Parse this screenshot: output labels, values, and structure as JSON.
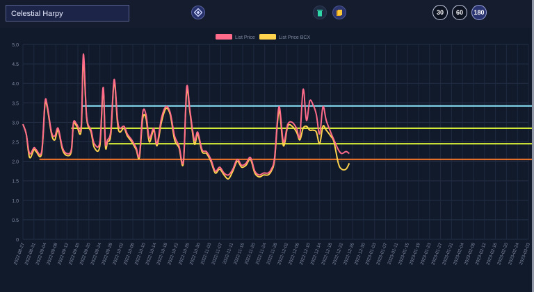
{
  "header": {
    "title": "Celestial Harpy",
    "range_buttons": [
      "30",
      "60",
      "180"
    ],
    "active_range": "180",
    "icons": [
      "logo-icon",
      "trash-icon",
      "cards-icon"
    ]
  },
  "colors": {
    "background": "#111a2b",
    "list_price": "#ff6b8a",
    "list_price_bcx": "#ffd34d",
    "line_cyan": "#8ee8ff",
    "line_yellow": "#e8ff3a",
    "line_orange": "#ff7a2a"
  },
  "chart_data": {
    "type": "line",
    "legend": [
      "List Price",
      "List Price BCX"
    ],
    "legend_position": "top",
    "ylim": [
      0,
      5
    ],
    "yticks": [
      "0",
      "0.5",
      "1.0",
      "1.5",
      "2.0",
      "2.5",
      "3.0",
      "3.5",
      "4.0",
      "4.5",
      "5.0"
    ],
    "xticks": [
      "2022-08-27",
      "2022-08-31",
      "2022-09-04",
      "2022-09-08",
      "2022-09-12",
      "2022-09-16",
      "2022-09-20",
      "2022-09-24",
      "2022-09-28",
      "2022-10-02",
      "2022-10-06",
      "2022-10-10",
      "2022-10-14",
      "2022-10-18",
      "2022-10-22",
      "2022-10-26",
      "2022-10-30",
      "2022-11-03",
      "2022-11-07",
      "2022-11-11",
      "2022-11-16",
      "2022-11-20",
      "2022-11-24",
      "2022-11-28",
      "2022-12-02",
      "2022-12-06",
      "2022-12-10",
      "2022-12-14",
      "2022-12-18",
      "2022-12-22",
      "2022-12-26",
      "2022-12-30",
      "2023-01-03",
      "2023-01-07",
      "2023-01-11",
      "2023-01-15",
      "2023-01-19",
      "2023-01-23",
      "2023-01-27",
      "2023-01-31",
      "2023-02-04",
      "2023-02-08",
      "2023-02-12",
      "2023-02-16",
      "2023-02-20",
      "2023-02-24",
      "2023-03-03"
    ],
    "grid": true,
    "series": [
      {
        "name": "List Price",
        "points": [
          [
            0,
            2.95
          ],
          [
            0.3,
            2.7
          ],
          [
            0.6,
            2.2
          ],
          [
            1.0,
            2.35
          ],
          [
            1.2,
            2.3
          ],
          [
            1.7,
            2.25
          ],
          [
            2.0,
            3.5
          ],
          [
            2.2,
            3.45
          ],
          [
            2.6,
            2.75
          ],
          [
            2.9,
            2.65
          ],
          [
            3.2,
            2.85
          ],
          [
            3.6,
            2.35
          ],
          [
            4.0,
            2.2
          ],
          [
            4.4,
            2.3
          ],
          [
            4.6,
            3.0
          ],
          [
            4.9,
            2.95
          ],
          [
            5.3,
            2.9
          ],
          [
            5.5,
            4.75
          ],
          [
            5.8,
            3.15
          ],
          [
            6.2,
            2.8
          ],
          [
            6.5,
            2.45
          ],
          [
            7.0,
            2.5
          ],
          [
            7.3,
            3.9
          ],
          [
            7.5,
            2.5
          ],
          [
            7.7,
            2.55
          ],
          [
            8.0,
            2.8
          ],
          [
            8.3,
            4.1
          ],
          [
            8.6,
            3.1
          ],
          [
            8.8,
            2.85
          ],
          [
            9.2,
            2.9
          ],
          [
            9.5,
            2.7
          ],
          [
            9.9,
            2.55
          ],
          [
            10.3,
            2.35
          ],
          [
            10.6,
            2.15
          ],
          [
            10.9,
            3.25
          ],
          [
            11.2,
            3.2
          ],
          [
            11.5,
            2.6
          ],
          [
            11.9,
            2.85
          ],
          [
            12.2,
            2.45
          ],
          [
            12.6,
            3.1
          ],
          [
            13.0,
            3.4
          ],
          [
            13.4,
            3.25
          ],
          [
            13.8,
            2.65
          ],
          [
            14.2,
            2.4
          ],
          [
            14.6,
            2.0
          ],
          [
            14.9,
            3.9
          ],
          [
            15.2,
            3.3
          ],
          [
            15.6,
            2.55
          ],
          [
            15.9,
            2.75
          ],
          [
            16.3,
            2.3
          ],
          [
            16.7,
            2.25
          ],
          [
            17.1,
            2.05
          ],
          [
            17.5,
            1.75
          ],
          [
            17.9,
            1.85
          ],
          [
            18.3,
            1.7
          ],
          [
            18.7,
            1.65
          ],
          [
            19.1,
            1.8
          ],
          [
            19.5,
            2.05
          ],
          [
            19.9,
            1.9
          ],
          [
            20.3,
            1.95
          ],
          [
            20.7,
            2.1
          ],
          [
            21.1,
            1.75
          ],
          [
            21.5,
            1.65
          ],
          [
            21.9,
            1.7
          ],
          [
            22.3,
            1.7
          ],
          [
            22.6,
            1.8
          ],
          [
            22.9,
            2.1
          ],
          [
            23.3,
            3.4
          ],
          [
            23.7,
            2.5
          ],
          [
            24.1,
            2.95
          ],
          [
            24.5,
            3.0
          ],
          [
            24.9,
            2.85
          ],
          [
            25.2,
            2.65
          ],
          [
            25.5,
            3.85
          ],
          [
            25.8,
            3.05
          ],
          [
            26.1,
            3.55
          ],
          [
            26.4,
            3.45
          ],
          [
            26.7,
            3.2
          ],
          [
            27.0,
            2.7
          ],
          [
            27.3,
            3.4
          ],
          [
            27.6,
            3.05
          ],
          [
            28.0,
            2.75
          ],
          [
            28.3,
            2.55
          ],
          [
            28.7,
            2.3
          ],
          [
            29.0,
            2.2
          ],
          [
            29.4,
            2.25
          ],
          [
            29.7,
            2.2
          ]
        ]
      },
      {
        "name": "List Price BCX",
        "points": [
          [
            0,
            2.95
          ],
          [
            0.3,
            2.7
          ],
          [
            0.6,
            2.1
          ],
          [
            1.0,
            2.3
          ],
          [
            1.2,
            2.25
          ],
          [
            1.7,
            2.2
          ],
          [
            2.0,
            3.45
          ],
          [
            2.2,
            3.4
          ],
          [
            2.6,
            2.7
          ],
          [
            2.9,
            2.55
          ],
          [
            3.2,
            2.8
          ],
          [
            3.6,
            2.3
          ],
          [
            4.0,
            2.15
          ],
          [
            4.4,
            2.25
          ],
          [
            4.6,
            2.95
          ],
          [
            4.9,
            2.9
          ],
          [
            5.3,
            2.8
          ],
          [
            5.5,
            4.6
          ],
          [
            5.8,
            3.1
          ],
          [
            6.2,
            2.75
          ],
          [
            6.5,
            2.35
          ],
          [
            7.0,
            2.4
          ],
          [
            7.3,
            3.85
          ],
          [
            7.5,
            2.4
          ],
          [
            7.7,
            2.5
          ],
          [
            8.0,
            2.7
          ],
          [
            8.3,
            4.05
          ],
          [
            8.6,
            3.0
          ],
          [
            8.8,
            2.75
          ],
          [
            9.2,
            2.85
          ],
          [
            9.5,
            2.65
          ],
          [
            9.9,
            2.5
          ],
          [
            10.3,
            2.3
          ],
          [
            10.6,
            2.1
          ],
          [
            10.9,
            3.1
          ],
          [
            11.2,
            3.1
          ],
          [
            11.5,
            2.5
          ],
          [
            11.9,
            2.8
          ],
          [
            12.2,
            2.4
          ],
          [
            12.6,
            3.0
          ],
          [
            13.0,
            3.35
          ],
          [
            13.4,
            3.2
          ],
          [
            13.8,
            2.55
          ],
          [
            14.2,
            2.35
          ],
          [
            14.6,
            1.95
          ],
          [
            14.9,
            3.8
          ],
          [
            15.2,
            3.25
          ],
          [
            15.6,
            2.45
          ],
          [
            15.9,
            2.7
          ],
          [
            16.3,
            2.25
          ],
          [
            16.7,
            2.2
          ],
          [
            17.1,
            2.0
          ],
          [
            17.5,
            1.7
          ],
          [
            17.9,
            1.8
          ],
          [
            18.3,
            1.65
          ],
          [
            18.7,
            1.55
          ],
          [
            19.1,
            1.75
          ],
          [
            19.5,
            2.0
          ],
          [
            19.9,
            1.85
          ],
          [
            20.3,
            1.9
          ],
          [
            20.7,
            2.05
          ],
          [
            21.1,
            1.7
          ],
          [
            21.5,
            1.6
          ],
          [
            21.9,
            1.65
          ],
          [
            22.3,
            1.65
          ],
          [
            22.6,
            1.75
          ],
          [
            22.9,
            2.05
          ],
          [
            23.3,
            3.3
          ],
          [
            23.7,
            2.4
          ],
          [
            24.1,
            2.9
          ],
          [
            24.5,
            2.9
          ],
          [
            24.9,
            2.75
          ],
          [
            25.2,
            2.55
          ],
          [
            25.5,
            2.85
          ],
          [
            25.8,
            2.9
          ],
          [
            26.1,
            2.8
          ],
          [
            26.4,
            2.8
          ],
          [
            26.7,
            2.75
          ],
          [
            27.0,
            2.45
          ],
          [
            27.3,
            2.9
          ],
          [
            27.6,
            2.8
          ],
          [
            28.0,
            2.65
          ],
          [
            28.3,
            2.5
          ],
          [
            28.7,
            1.95
          ],
          [
            29.0,
            1.8
          ],
          [
            29.4,
            1.8
          ],
          [
            29.7,
            1.95
          ]
        ]
      }
    ],
    "reference_lines": [
      {
        "y": 3.42,
        "x_start": 5.4,
        "color": "#8ee8ff"
      },
      {
        "y": 2.85,
        "x_start": 4.4,
        "color": "#e8ff3a"
      },
      {
        "y": 2.45,
        "x_start": 7.8,
        "color": "#e8ff3a"
      },
      {
        "y": 2.05,
        "x_start": 1.5,
        "color": "#ff7a2a"
      }
    ]
  }
}
